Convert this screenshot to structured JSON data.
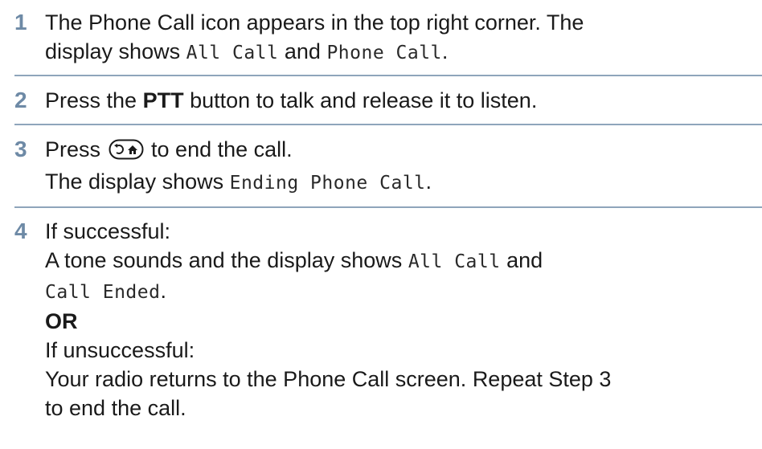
{
  "colors": {
    "step_number": "#6e8aa6",
    "rule": "#8fa5bb",
    "text": "#1a1a1a"
  },
  "steps": [
    {
      "number": "1",
      "line1_text": "The Phone Call icon appears in the top right corner. The",
      "line2_prefix": "display shows ",
      "line2_code1": "All Call",
      "line2_mid": " and ",
      "line2_code2": "Phone Call",
      "line2_suffix": "."
    },
    {
      "number": "2",
      "prefix": "Press the ",
      "bold": "PTT",
      "suffix": " button to talk and release it to listen."
    },
    {
      "number": "3",
      "line1_prefix": "Press ",
      "line1_icon": "back-home-key-icon",
      "line1_suffix": " to end the call.",
      "line2_prefix": "The display shows ",
      "line2_code": "Ending Phone Call",
      "line2_suffix": "."
    },
    {
      "number": "4",
      "line1": "If successful:",
      "line2_prefix": "A tone sounds and the display shows ",
      "line2_code": "All Call",
      "line2_suffix": " and",
      "line3_code": "Call Ended",
      "line3_suffix": ".",
      "or_label": "OR",
      "line5": "If unsuccessful:",
      "line6": "Your radio returns to the Phone Call screen. Repeat Step 3",
      "line7": "to end the call."
    }
  ]
}
